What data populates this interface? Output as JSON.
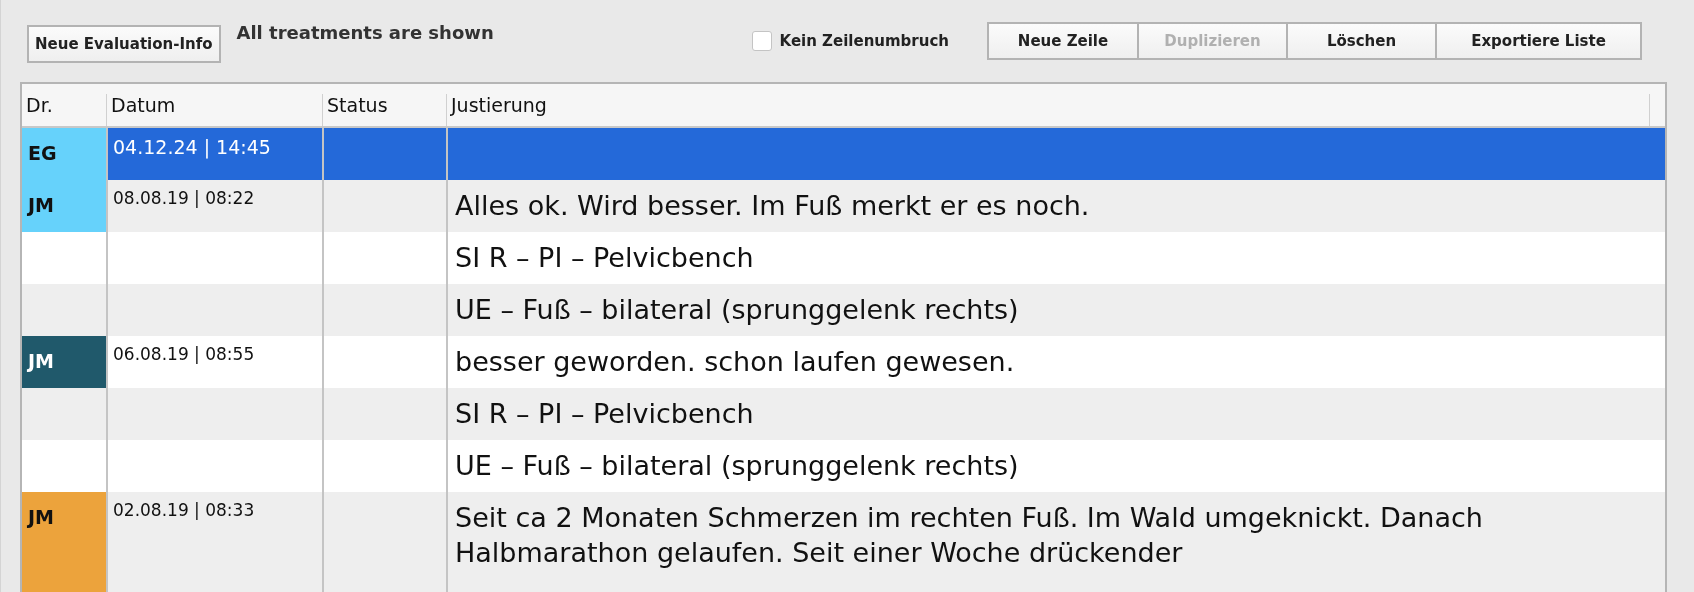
{
  "toolbar": {
    "evaluation_button": "Neue Evaluation-Info",
    "filter_label": "All treatments are shown",
    "no_wrap": {
      "label": "Kein Zeilenumbruch",
      "checked": false
    },
    "buttons": [
      {
        "label": "Neue Zeile",
        "disabled": false
      },
      {
        "label": "Duplizieren",
        "disabled": true
      },
      {
        "label": "Löschen",
        "disabled": false
      },
      {
        "label": "Exportiere Liste",
        "disabled": false
      }
    ]
  },
  "table": {
    "columns": [
      "Dr.",
      "Datum",
      "Status",
      "Justierung"
    ],
    "entries": [
      {
        "doctor": "EG",
        "color": "#66d2fb",
        "date": "04.12.24 | 14:45",
        "selected": true
      },
      {
        "doctor": "JM",
        "color": "#66d2fb",
        "date": "08.08.19 | 08:22",
        "selected": false,
        "lines": [
          "Alles ok. Wird besser. Im Fuß merkt er es noch.",
          "SI R – PI – Pelvicbench",
          "UE – Fuß – bilateral (sprunggelenk rechts)"
        ]
      },
      {
        "doctor": "JM",
        "color": "#20596b",
        "date": "06.08.19 | 08:55",
        "selected": false,
        "lines": [
          "besser geworden. schon laufen gewesen.",
          "SI R – PI – Pelvicbench",
          "UE – Fuß – bilateral (sprunggelenk rechts)"
        ]
      },
      {
        "doctor": "JM",
        "color": "#eca33c",
        "date": "02.08.19 | 08:33",
        "selected": false,
        "lines": [
          "Seit ca 2 Monaten Schmerzen im rechten Fuß. Im Wald umgeknickt. Danach Halbmarathon gelaufen. Seit einer Woche drückender"
        ]
      }
    ]
  }
}
